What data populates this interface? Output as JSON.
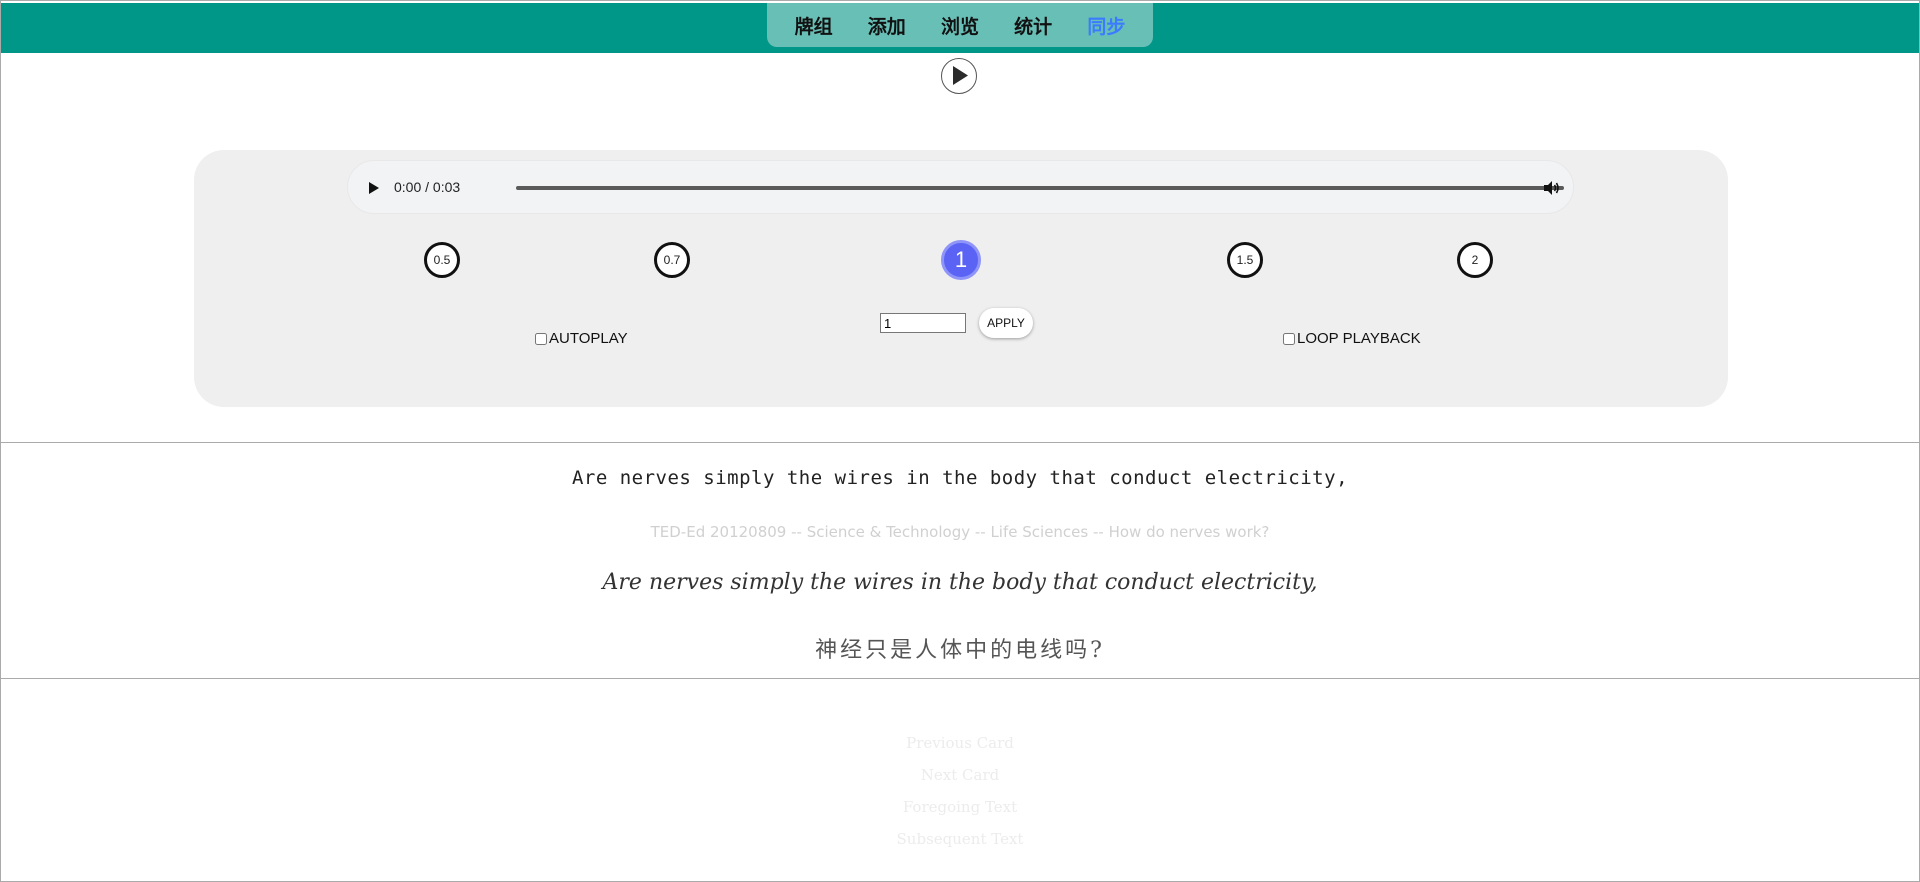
{
  "nav": {
    "tabs": [
      {
        "label": "牌组"
      },
      {
        "label": "添加"
      },
      {
        "label": "浏览"
      },
      {
        "label": "统计"
      },
      {
        "label": "同步",
        "active": true
      }
    ]
  },
  "audio": {
    "time": "0:00 / 0:03"
  },
  "speed": {
    "options": [
      "0.5",
      "0.7",
      "1",
      "1.5",
      "2"
    ],
    "selected": "1",
    "input_value": "1",
    "apply_label": "APPLY"
  },
  "options": {
    "autoplay_label": "AUTOPLAY",
    "loop_label": "LOOP PLAYBACK"
  },
  "card": {
    "sentence_mono": "Are nerves simply the wires in the body that conduct electricity,",
    "source": "TED-Ed 20120809 -- Science & Technology -- Life Sciences -- How do nerves work?",
    "sentence_hand": "Are nerves simply the wires in the body that conduct electricity,",
    "translation": "神经只是人体中的电线吗?"
  },
  "links": {
    "previous": "Previous Card",
    "next": "Next Card",
    "foregoing": "Foregoing Text",
    "subsequent": "Subsequent Text"
  },
  "colors": {
    "topbar": "#009688",
    "tabs_bg": "#68bfb6",
    "active_tab": "#3b7bff",
    "speed_active": "#5b63f5"
  }
}
